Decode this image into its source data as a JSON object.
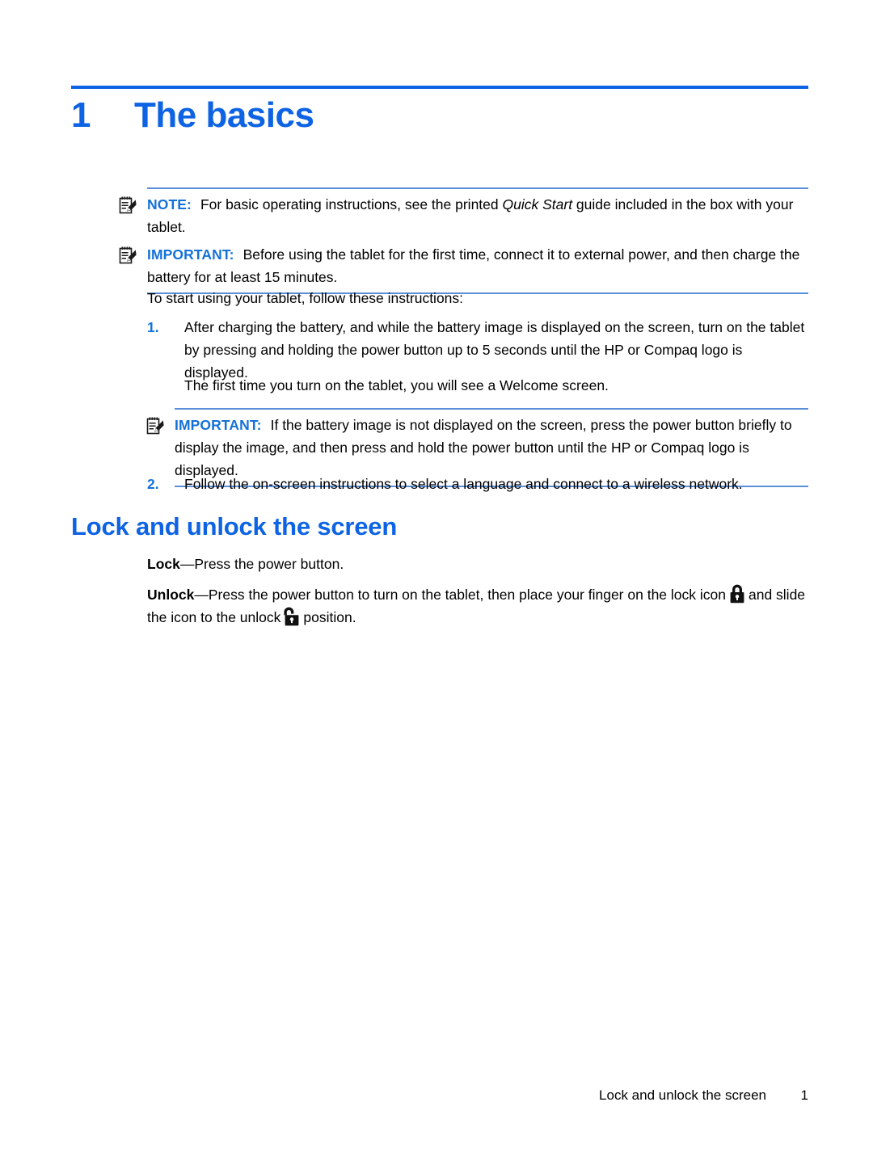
{
  "document": {
    "chapter_number": "1",
    "chapter_title": "The basics"
  },
  "notes": {
    "note_label": "NOTE:",
    "note_text_before_italic": "For basic operating instructions, see the printed ",
    "note_italic": "Quick Start",
    "note_text_after_italic": " guide included in the box with your tablet.",
    "important1_label": "IMPORTANT:",
    "important1_text": "Before using the tablet for the first time, connect it to external power, and then charge the battery for at least 15 minutes.",
    "important2_label": "IMPORTANT:",
    "important2_text": "If the battery image is not displayed on the screen, press the power button briefly to display the image, and then press and hold the power button until the HP or Compaq logo is displayed.",
    "icon_name": "note-pencil-icon"
  },
  "intro": {
    "lead_in": "To start using your tablet, follow these instructions:"
  },
  "steps": [
    {
      "number": "1.",
      "text": "After charging the battery, and while the battery image is displayed on the screen, turn on the tablet by pressing and holding the power button up to 5 seconds until the HP or Compaq logo is displayed."
    },
    {
      "number": "2.",
      "text": "Follow the on-screen instructions to select a language and connect to a wireless network."
    }
  ],
  "step1_followup": "The first time you turn on the tablet, you will see a Welcome screen.",
  "section": {
    "heading": "Lock and unlock the screen",
    "lock_term": "Lock",
    "lock_text": "—Press the power button.",
    "unlock_term": "Unlock",
    "unlock_text_1": "—Press the power button to turn on the tablet, then place your finger on the lock icon",
    "unlock_text_2": "and slide the icon to the unlock",
    "unlock_text_3": "position.",
    "lock_icon_name": "padlock-closed-icon",
    "unlock_icon_name": "padlock-open-icon"
  },
  "footer": {
    "title": "Lock and unlock the screen",
    "page_number": "1"
  },
  "colors": {
    "heading_blue": "#0d63e3",
    "label_blue": "#1471d8",
    "rule_blue": "#5b8fd8",
    "body_black": "#000000"
  }
}
